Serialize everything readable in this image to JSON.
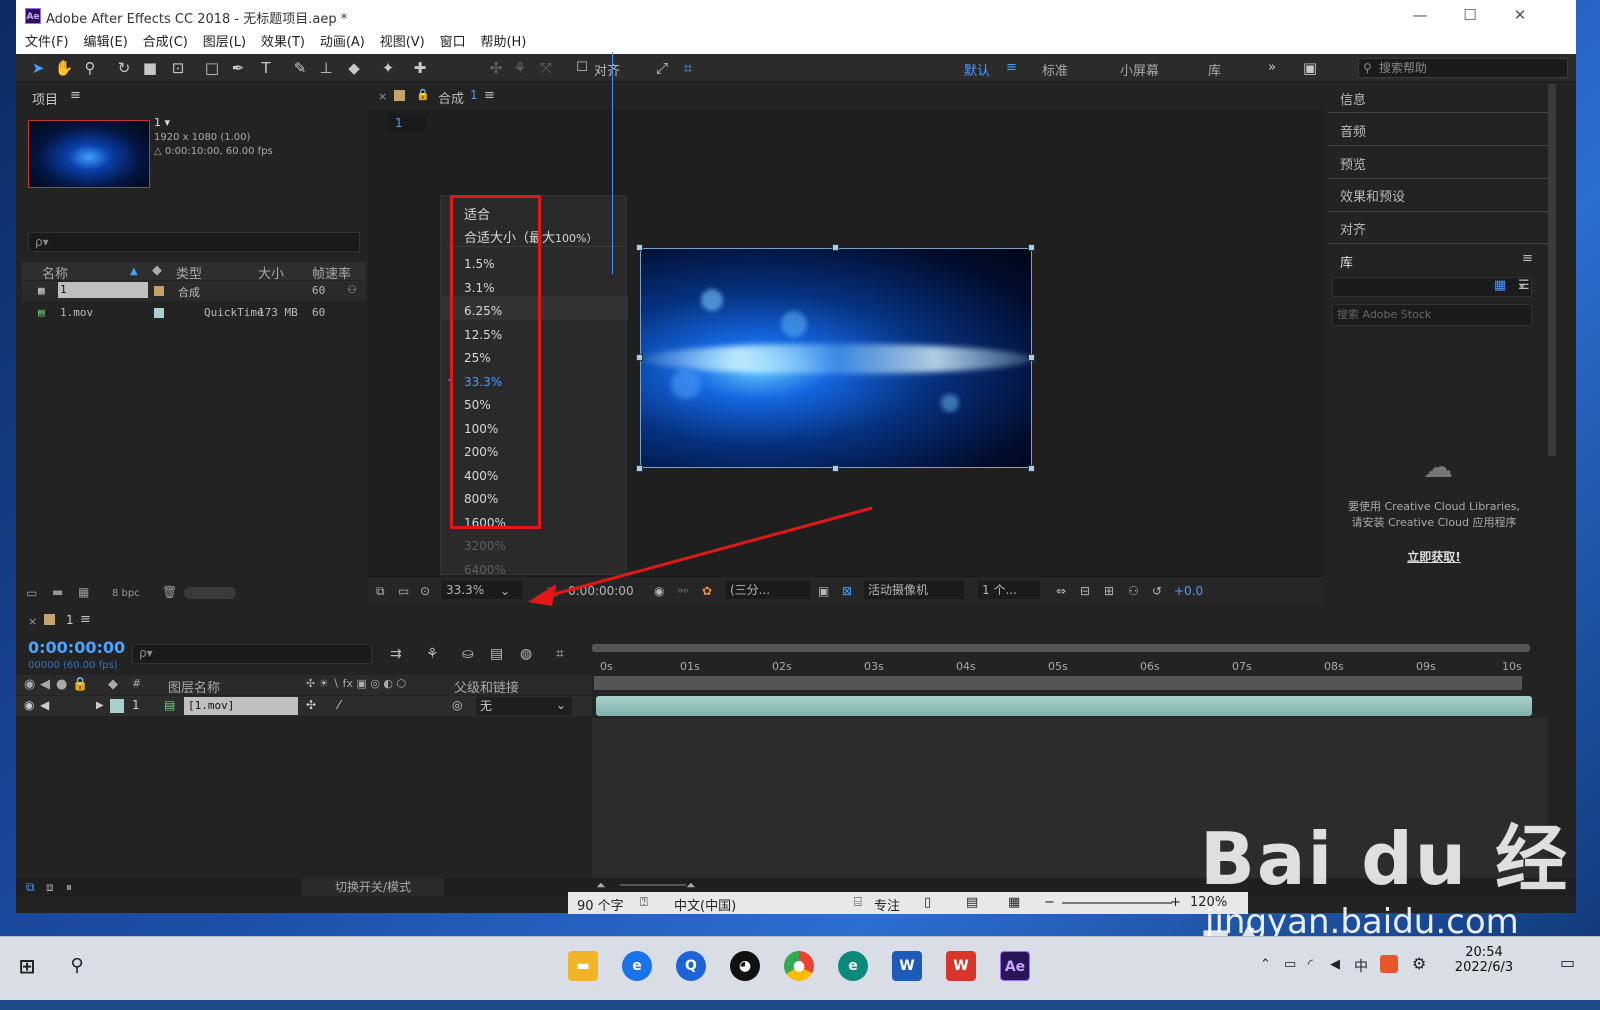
{
  "window": {
    "title": "Adobe After Effects CC 2018 - 无标题项目.aep *",
    "app_icon": "Ae",
    "minimize": "—",
    "maximize": "☐",
    "close": "✕"
  },
  "menu": [
    "文件(F)",
    "编辑(E)",
    "合成(C)",
    "图层(L)",
    "效果(T)",
    "动画(A)",
    "视图(V)",
    "窗口",
    "帮助(H)"
  ],
  "toolbar": {
    "snap_label": "对齐",
    "workspaces": [
      "默认",
      "标准",
      "小屏幕",
      "库"
    ],
    "active_workspace": "默认",
    "more": "»",
    "search_placeholder": "搜索帮助"
  },
  "project": {
    "title": "项目",
    "comp_name": "1 ▾",
    "comp_info1": "1920 x 1080 (1.00)",
    "comp_info2": "△ 0:00:10:00, 60.00 fps",
    "search_placeholder": "ρ▾",
    "columns": [
      "名称",
      "类型",
      "大小",
      "帧速率"
    ],
    "items": [
      {
        "name": "1",
        "type": "合成",
        "size": "",
        "fps": "60"
      },
      {
        "name": "1.mov",
        "type": "QuickTime",
        "size": "173 MB",
        "fps": "60"
      }
    ],
    "bpc": "8 bpc"
  },
  "composition": {
    "tab_label": "合成",
    "tab_number": "1",
    "subtab": "1",
    "zoom_menu": {
      "header1": "适合",
      "header2a": "合适大小（最大",
      "header2b": "100%）",
      "items": [
        "1.5%",
        "3.1%",
        "6.25%",
        "12.5%",
        "25%",
        "33.3%",
        "50%",
        "100%",
        "200%",
        "400%",
        "800%",
        "1600%",
        "3200%",
        "6400%"
      ],
      "selected": "33.3%",
      "disabled": [
        "3200%",
        "6400%"
      ]
    },
    "footer": {
      "zoom": "33.3%",
      "timecode": "0:00:00:00",
      "resolution": "(三分...",
      "camera": "活动摄像机",
      "views": "1 个...",
      "exposure": "+0.0"
    }
  },
  "right_panels": {
    "items": [
      "信息",
      "音频",
      "预览",
      "效果和预设",
      "对齐"
    ],
    "library_title": "库",
    "library_search": "搜索 Adobe Stock",
    "cc_msg1": "要使用 Creative Cloud Libraries,",
    "cc_msg2": "请安装 Creative Cloud 应用程序",
    "cc_link": "立即获取!"
  },
  "timeline": {
    "tab": "1",
    "timecode": "0:00:00:00",
    "fps": "00000 (60.00 fps)",
    "col_layer_name": "图层名称",
    "col_parent": "父级和链接",
    "col_hash": "#",
    "layer": {
      "index": "1",
      "name": "[1.mov]",
      "parent": "无"
    },
    "ticks": [
      "0s",
      "01s",
      "02s",
      "03s",
      "04s",
      "05s",
      "06s",
      "07s",
      "08s",
      "09s",
      "10s"
    ],
    "footer_toggle": "切换开关/模式"
  },
  "statusbar": {
    "chars": "90 个字",
    "lang": "中文(中国)",
    "focus": "专注",
    "zoom": "120%"
  },
  "taskbar": {
    "time": "20:54",
    "date": "2022/6/3",
    "ime": "中"
  },
  "watermark": {
    "brand": "Bai du 经验",
    "url": "jingyan.baidu.com"
  }
}
